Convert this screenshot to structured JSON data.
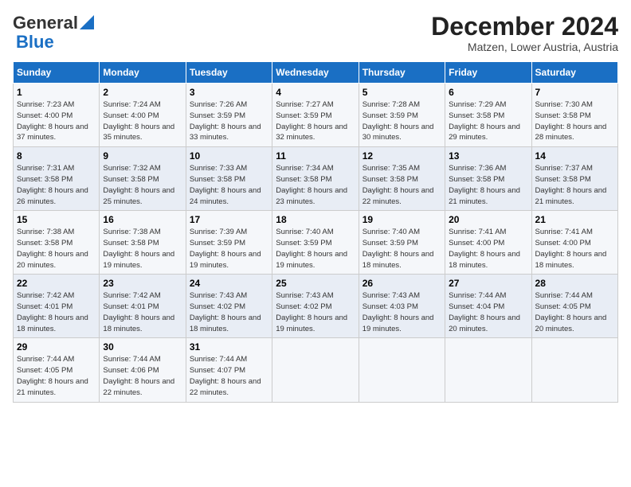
{
  "header": {
    "logo_line1": "General",
    "logo_line2": "Blue",
    "title": "December 2024",
    "subtitle": "Matzen, Lower Austria, Austria"
  },
  "days_of_week": [
    "Sunday",
    "Monday",
    "Tuesday",
    "Wednesday",
    "Thursday",
    "Friday",
    "Saturday"
  ],
  "weeks": [
    [
      {
        "day": 1,
        "sunrise": "7:23 AM",
        "sunset": "4:00 PM",
        "daylight": "8 hours and 37 minutes."
      },
      {
        "day": 2,
        "sunrise": "7:24 AM",
        "sunset": "4:00 PM",
        "daylight": "8 hours and 35 minutes."
      },
      {
        "day": 3,
        "sunrise": "7:26 AM",
        "sunset": "3:59 PM",
        "daylight": "8 hours and 33 minutes."
      },
      {
        "day": 4,
        "sunrise": "7:27 AM",
        "sunset": "3:59 PM",
        "daylight": "8 hours and 32 minutes."
      },
      {
        "day": 5,
        "sunrise": "7:28 AM",
        "sunset": "3:59 PM",
        "daylight": "8 hours and 30 minutes."
      },
      {
        "day": 6,
        "sunrise": "7:29 AM",
        "sunset": "3:58 PM",
        "daylight": "8 hours and 29 minutes."
      },
      {
        "day": 7,
        "sunrise": "7:30 AM",
        "sunset": "3:58 PM",
        "daylight": "8 hours and 28 minutes."
      }
    ],
    [
      {
        "day": 8,
        "sunrise": "7:31 AM",
        "sunset": "3:58 PM",
        "daylight": "8 hours and 26 minutes."
      },
      {
        "day": 9,
        "sunrise": "7:32 AM",
        "sunset": "3:58 PM",
        "daylight": "8 hours and 25 minutes."
      },
      {
        "day": 10,
        "sunrise": "7:33 AM",
        "sunset": "3:58 PM",
        "daylight": "8 hours and 24 minutes."
      },
      {
        "day": 11,
        "sunrise": "7:34 AM",
        "sunset": "3:58 PM",
        "daylight": "8 hours and 23 minutes."
      },
      {
        "day": 12,
        "sunrise": "7:35 AM",
        "sunset": "3:58 PM",
        "daylight": "8 hours and 22 minutes."
      },
      {
        "day": 13,
        "sunrise": "7:36 AM",
        "sunset": "3:58 PM",
        "daylight": "8 hours and 21 minutes."
      },
      {
        "day": 14,
        "sunrise": "7:37 AM",
        "sunset": "3:58 PM",
        "daylight": "8 hours and 21 minutes."
      }
    ],
    [
      {
        "day": 15,
        "sunrise": "7:38 AM",
        "sunset": "3:58 PM",
        "daylight": "8 hours and 20 minutes."
      },
      {
        "day": 16,
        "sunrise": "7:38 AM",
        "sunset": "3:58 PM",
        "daylight": "8 hours and 19 minutes."
      },
      {
        "day": 17,
        "sunrise": "7:39 AM",
        "sunset": "3:59 PM",
        "daylight": "8 hours and 19 minutes."
      },
      {
        "day": 18,
        "sunrise": "7:40 AM",
        "sunset": "3:59 PM",
        "daylight": "8 hours and 19 minutes."
      },
      {
        "day": 19,
        "sunrise": "7:40 AM",
        "sunset": "3:59 PM",
        "daylight": "8 hours and 18 minutes."
      },
      {
        "day": 20,
        "sunrise": "7:41 AM",
        "sunset": "4:00 PM",
        "daylight": "8 hours and 18 minutes."
      },
      {
        "day": 21,
        "sunrise": "7:41 AM",
        "sunset": "4:00 PM",
        "daylight": "8 hours and 18 minutes."
      }
    ],
    [
      {
        "day": 22,
        "sunrise": "7:42 AM",
        "sunset": "4:01 PM",
        "daylight": "8 hours and 18 minutes."
      },
      {
        "day": 23,
        "sunrise": "7:42 AM",
        "sunset": "4:01 PM",
        "daylight": "8 hours and 18 minutes."
      },
      {
        "day": 24,
        "sunrise": "7:43 AM",
        "sunset": "4:02 PM",
        "daylight": "8 hours and 18 minutes."
      },
      {
        "day": 25,
        "sunrise": "7:43 AM",
        "sunset": "4:02 PM",
        "daylight": "8 hours and 19 minutes."
      },
      {
        "day": 26,
        "sunrise": "7:43 AM",
        "sunset": "4:03 PM",
        "daylight": "8 hours and 19 minutes."
      },
      {
        "day": 27,
        "sunrise": "7:44 AM",
        "sunset": "4:04 PM",
        "daylight": "8 hours and 20 minutes."
      },
      {
        "day": 28,
        "sunrise": "7:44 AM",
        "sunset": "4:05 PM",
        "daylight": "8 hours and 20 minutes."
      }
    ],
    [
      {
        "day": 29,
        "sunrise": "7:44 AM",
        "sunset": "4:05 PM",
        "daylight": "8 hours and 21 minutes."
      },
      {
        "day": 30,
        "sunrise": "7:44 AM",
        "sunset": "4:06 PM",
        "daylight": "8 hours and 22 minutes."
      },
      {
        "day": 31,
        "sunrise": "7:44 AM",
        "sunset": "4:07 PM",
        "daylight": "8 hours and 22 minutes."
      },
      null,
      null,
      null,
      null
    ]
  ]
}
